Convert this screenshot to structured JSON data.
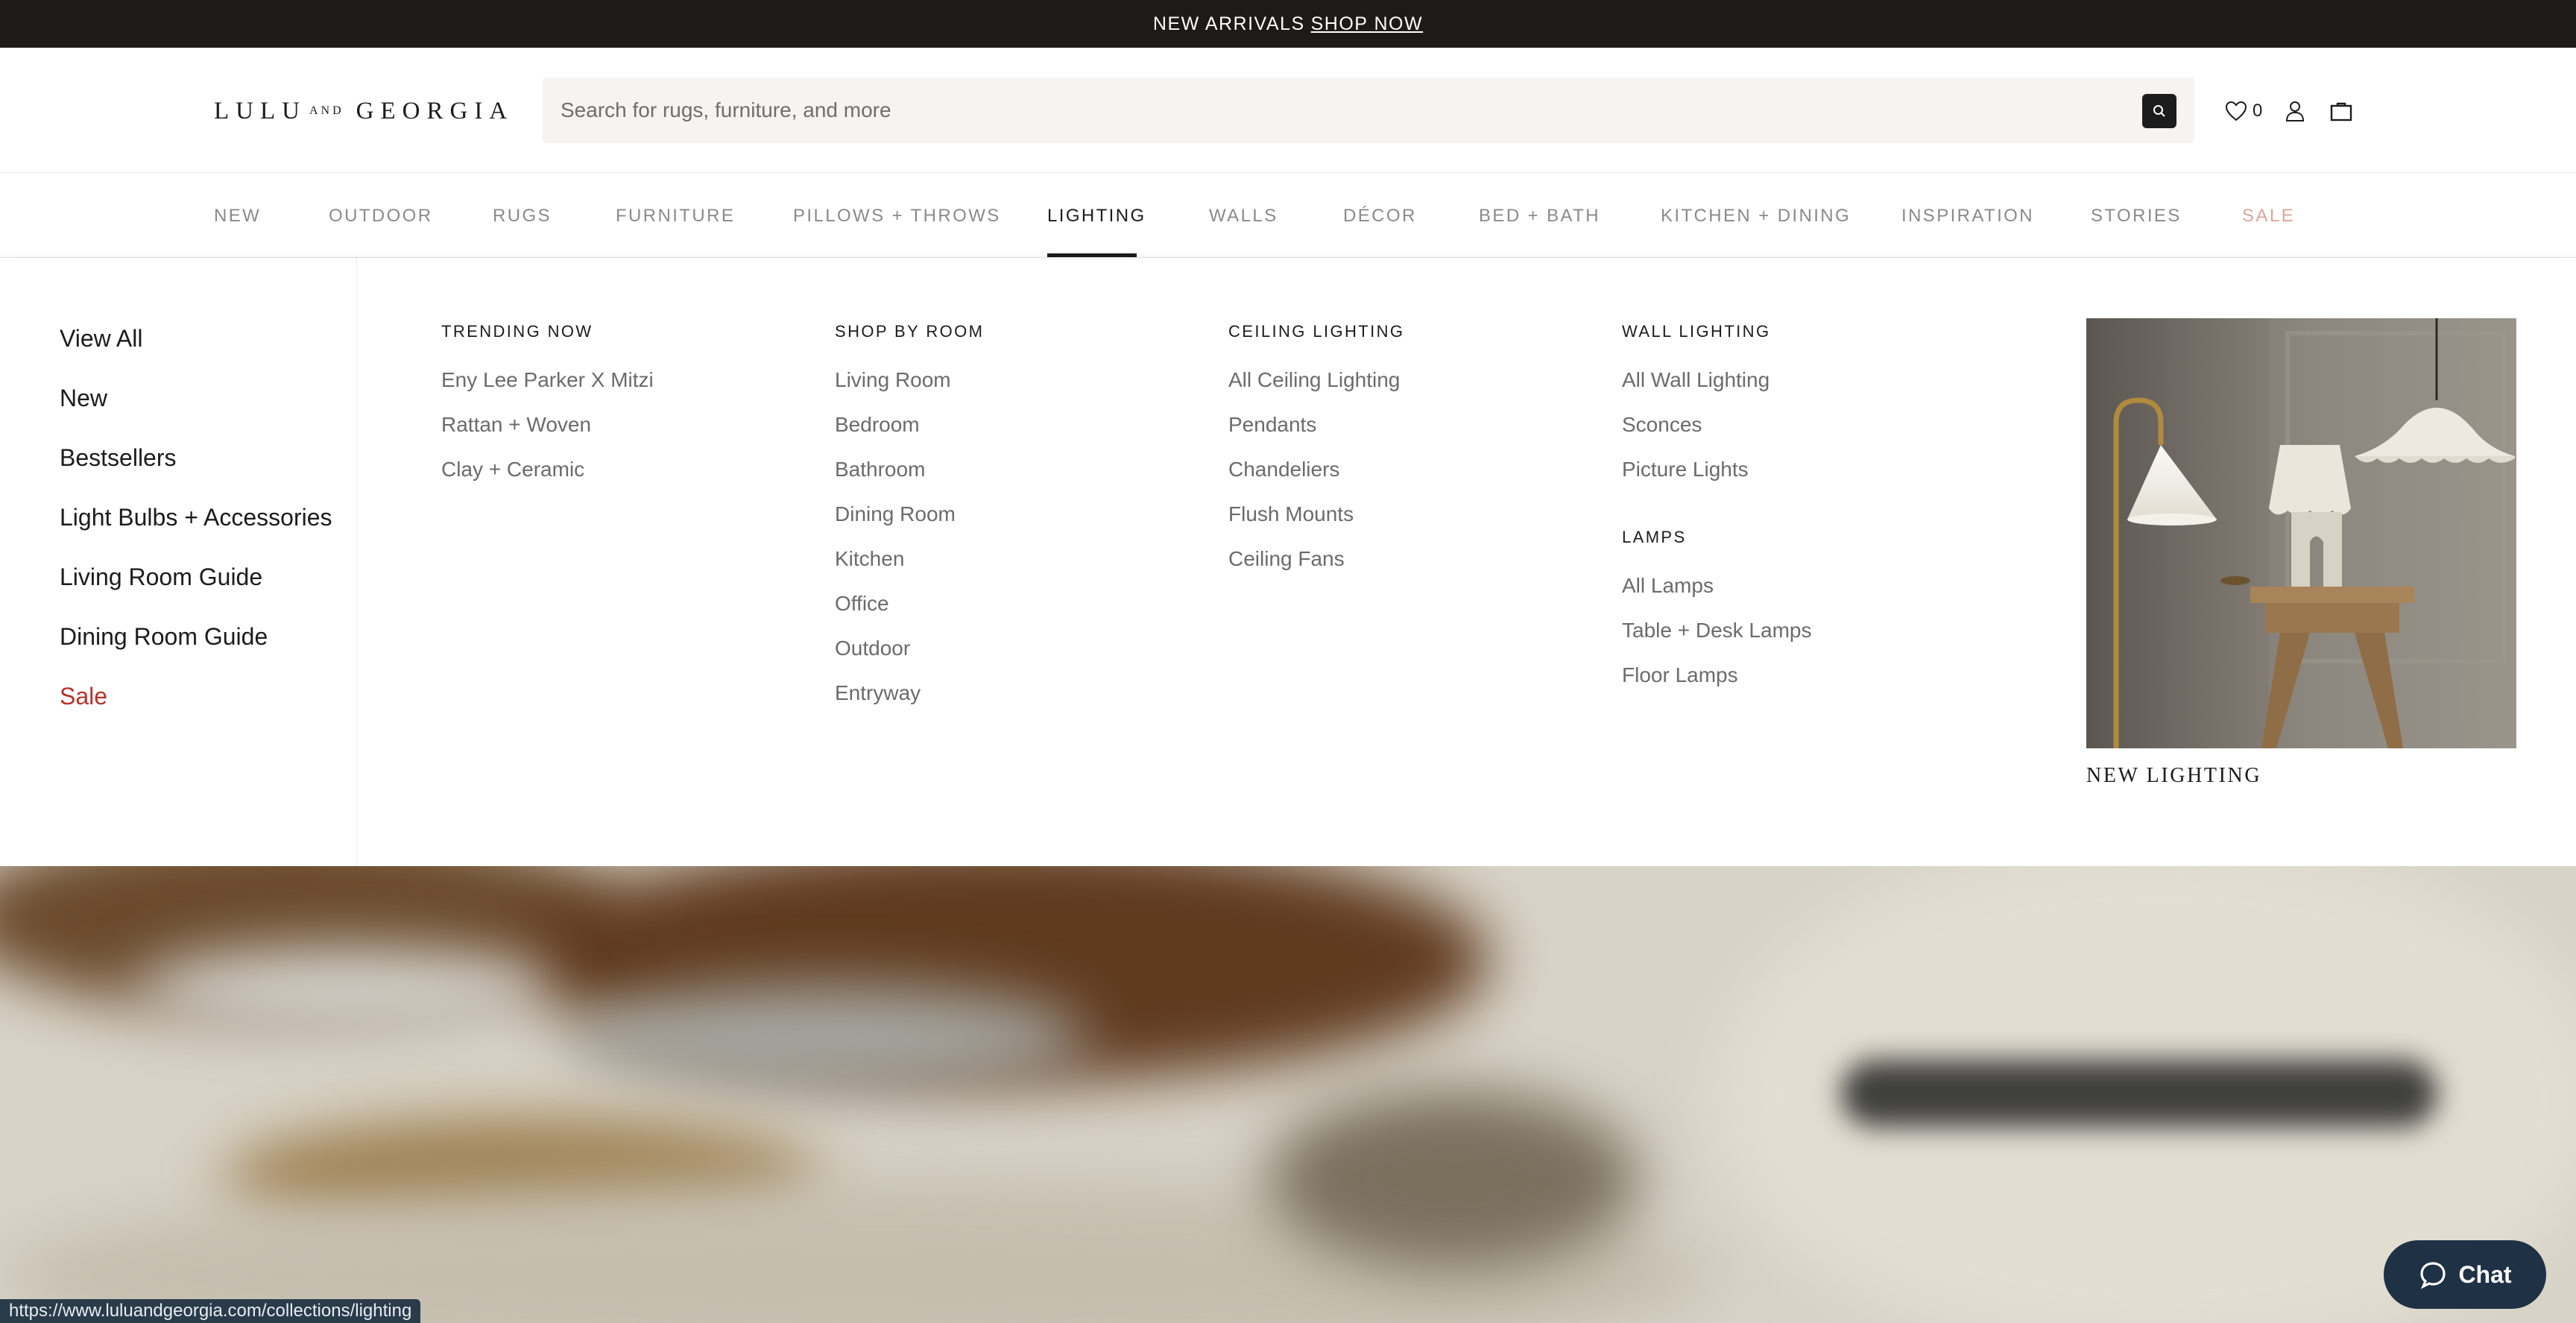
{
  "announcement": {
    "text": "NEW ARRIVALS",
    "link": "SHOP NOW"
  },
  "header": {
    "logo_left": "LULU",
    "logo_and": "AND",
    "logo_right": "GEORGIA",
    "search_placeholder": "Search for rugs, furniture, and more",
    "wishlist_count": "0"
  },
  "nav": {
    "items": [
      "NEW",
      "OUTDOOR",
      "RUGS",
      "FURNITURE",
      "PILLOWS + THROWS",
      "LIGHTING",
      "WALLS",
      "DÉCOR",
      "BED + BATH",
      "KITCHEN + DINING",
      "INSPIRATION",
      "STORIES",
      "SALE"
    ],
    "active": "LIGHTING"
  },
  "mega_menu": {
    "left_links": [
      "View All",
      "New",
      "Bestsellers",
      "Light Bulbs + Accessories",
      "Living Room Guide",
      "Dining Room Guide",
      "Sale"
    ],
    "trending": {
      "heading": "TRENDING NOW",
      "links": [
        "Eny Lee Parker X Mitzi",
        "Rattan + Woven",
        "Clay + Ceramic"
      ]
    },
    "shop_by_room": {
      "heading": "SHOP BY ROOM",
      "links": [
        "Living Room",
        "Bedroom",
        "Bathroom",
        "Dining Room",
        "Kitchen",
        "Office",
        "Outdoor",
        "Entryway"
      ]
    },
    "ceiling": {
      "heading": "CEILING LIGHTING",
      "links": [
        "All Ceiling Lighting",
        "Pendants",
        "Chandeliers",
        "Flush Mounts",
        "Ceiling Fans"
      ]
    },
    "wall": {
      "heading": "WALL LIGHTING",
      "links": [
        "All Wall Lighting",
        "Sconces",
        "Picture Lights"
      ]
    },
    "lamps": {
      "heading": "LAMPS",
      "links": [
        "All Lamps",
        "Table + Desk Lamps",
        "Floor Lamps"
      ]
    },
    "feature_caption": "NEW LIGHTING"
  },
  "status_url": "https://www.luluandgeorgia.com/collections/lighting",
  "chat_label": "Chat",
  "colors": {
    "accent_dark": "#1c1b18",
    "sale_red": "#b5332a",
    "chat_bg": "#1f3144"
  }
}
